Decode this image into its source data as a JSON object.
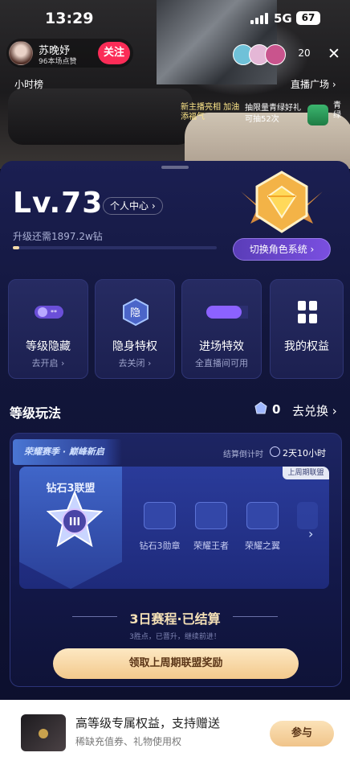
{
  "status_bar": {
    "time": "13:29",
    "network": "5G",
    "battery": "67"
  },
  "live_room": {
    "host_name": "苏晚妤",
    "host_likes": "96本场点赞",
    "follow_label": "关注",
    "viewer_count": "20",
    "close_icon": "close-icon",
    "hour_rank": "小时榜",
    "live_square": "直播广场 ›",
    "promo_left": "新主播亮相 加油添福气",
    "promo_mid_1": "抽限量青绿好礼",
    "promo_mid_2": "可抽52次",
    "promo_right": "青绿"
  },
  "level": {
    "title": "Lv.73",
    "profile_link": "个人中心 ›",
    "upgrade_note": "升级还需1897.2w钻",
    "progress_fraction": 0.03,
    "switch_role": "切换角色系统 ›"
  },
  "cards": [
    {
      "icon": "level-toggle-icon",
      "title": "等级隐藏",
      "sub": "去开启 ›"
    },
    {
      "icon": "stealth-icon",
      "title": "隐身特权",
      "sub": "去关闭 ›"
    },
    {
      "icon": "entrance-effect-icon",
      "title": "进场特效",
      "sub": "全直播间可用"
    },
    {
      "icon": "grid-icon",
      "title": "我的权益",
      "sub": ""
    }
  ],
  "gameplay": {
    "section_title": "等级玩法",
    "gem_count": "0",
    "exchange_label": "去兑换 ›"
  },
  "league": {
    "banner": "荣耀赛季 · 巅峰新启",
    "countdown_label": "结算倒计时",
    "countdown_value": "2天10小时",
    "last_tag": "上周期联盟",
    "tier_name": "钻石3联盟",
    "tier_numeral": "III",
    "rewards": [
      {
        "label": "钻石3勋章"
      },
      {
        "label": "荣耀王者"
      },
      {
        "label": "荣耀之翼"
      }
    ],
    "settle_title": "3日赛程·已结算",
    "settle_sub": "3胜点，已晋升，继续前进！",
    "claim_label": "领取上周期联盟奖励"
  },
  "bottom": {
    "title": "高等级专属权益，支持赠送",
    "sub": "稀缺充值券、礼物使用权",
    "join_label": "参与"
  }
}
